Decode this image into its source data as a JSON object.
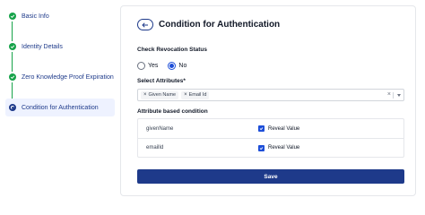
{
  "stepper": {
    "steps": [
      {
        "label": "Basic Info",
        "status": "done"
      },
      {
        "label": "Identity Details",
        "status": "done"
      },
      {
        "label": "Zero Knowledge Proof Expiration",
        "status": "done"
      },
      {
        "label": "Condition for Authentication",
        "status": "current"
      }
    ]
  },
  "main": {
    "title": "Condition for Authentication",
    "back_icon": "arrow-left-icon",
    "revocation": {
      "label": "Check Revocation Status",
      "options": [
        {
          "label": "Yes",
          "selected": false
        },
        {
          "label": "No",
          "selected": true
        }
      ]
    },
    "attributes": {
      "label": "Select Attributes*",
      "selected": [
        "Given Name",
        "Email Id"
      ],
      "clear_symbol": "×",
      "remove_symbol": "×"
    },
    "condition": {
      "label": "Attribute based condition",
      "rows": [
        {
          "attribute": "givenName",
          "check_label": "Reveal Value",
          "checked": true
        },
        {
          "attribute": "emailId",
          "check_label": "Reveal Value",
          "checked": true
        }
      ]
    },
    "save_label": "Save"
  },
  "colors": {
    "primary": "#1e3a8a",
    "success": "#16a34a",
    "checkbox": "#1d4ed8"
  }
}
